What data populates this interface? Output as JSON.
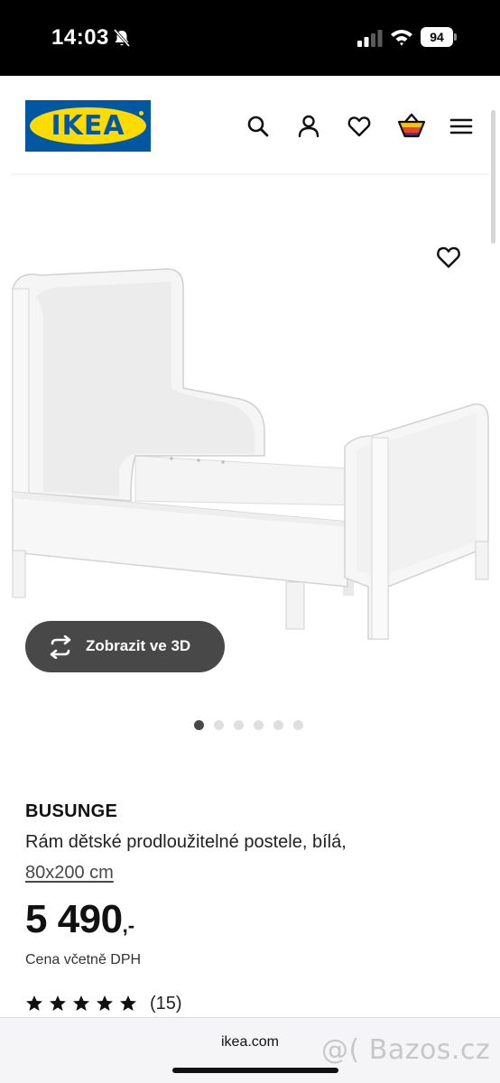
{
  "status_bar": {
    "time": "14:03",
    "battery": "94"
  },
  "header": {
    "logo_text": "IKEA",
    "icons": [
      "search-icon",
      "user-icon",
      "heart-icon",
      "basket-icon",
      "menu-icon"
    ]
  },
  "gallery": {
    "view_3d_label": "Zobrazit ve 3D",
    "image_count": 6,
    "active_index": 0
  },
  "product": {
    "name": "BUSUNGE",
    "description": "Rám dětské prodloužitelné postele, bílá,",
    "size": "80x200 cm",
    "price_integer": "5 490",
    "price_suffix": ",-",
    "price_note": "Cena včetně DPH",
    "rating_stars": 5,
    "rating_count": "(15)"
  },
  "browser": {
    "url": "ikea.com"
  },
  "watermark": "@( Bazos.cz",
  "colors": {
    "brand_blue": "#0058a3",
    "brand_yellow": "#ffdb00",
    "button_dark": "#484848"
  }
}
